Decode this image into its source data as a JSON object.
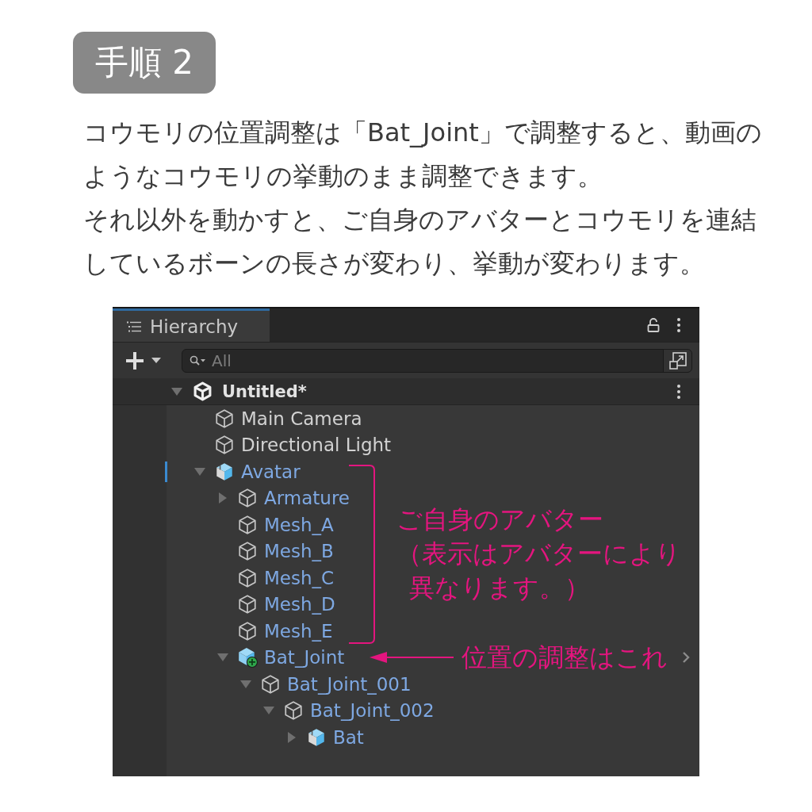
{
  "step_badge": "手順 2",
  "instructions": [
    "コウモリの位置調整は「Bat_Joint」で調整すると、動画のようなコウモリの挙動のまま調整できます。",
    "それ以外を動かすと、ご自身のアバターとコウモリを連結しているボーンの長さが変わり、挙動が変わります。"
  ],
  "hierarchy": {
    "tab": {
      "label": "Hierarchy",
      "selected": true
    },
    "search": {
      "placeholder": "All"
    },
    "scene": {
      "name": "Untitled*",
      "expanded": true
    },
    "nodes": [
      {
        "name": "Main Camera",
        "kind": "object",
        "marked": false,
        "chevron": false
      },
      {
        "name": "Directional Light",
        "kind": "object",
        "marked": false,
        "chevron": false
      },
      {
        "name": "Avatar",
        "kind": "prefab",
        "expanded": true,
        "marked": true,
        "chevron": false,
        "children": [
          {
            "name": "Armature",
            "kind": "prefab-part",
            "expanded": false,
            "marked": false,
            "chevron": false
          },
          {
            "name": "Mesh_A",
            "kind": "prefab-part",
            "marked": false,
            "chevron": false
          },
          {
            "name": "Mesh_B",
            "kind": "prefab-part",
            "marked": false,
            "chevron": false
          },
          {
            "name": "Mesh_C",
            "kind": "prefab-part",
            "marked": false,
            "chevron": false
          },
          {
            "name": "Mesh_D",
            "kind": "prefab-part",
            "marked": false,
            "chevron": false
          },
          {
            "name": "Mesh_E",
            "kind": "prefab-part",
            "marked": false,
            "chevron": false
          },
          {
            "name": "Bat_Joint",
            "kind": "added",
            "expanded": true,
            "marked": false,
            "chevron": true,
            "children": [
              {
                "name": "Bat_Joint_001",
                "kind": "prefab-part",
                "expanded": true,
                "marked": false,
                "chevron": false,
                "children": [
                  {
                    "name": "Bat_Joint_002",
                    "kind": "prefab-part",
                    "expanded": true,
                    "marked": false,
                    "chevron": false,
                    "children": [
                      {
                        "name": "Bat",
                        "kind": "prefab",
                        "expanded": false,
                        "marked": false,
                        "chevron": false
                      }
                    ]
                  }
                ]
              }
            ]
          }
        ]
      }
    ]
  },
  "annotations": {
    "bracket_label": "ご自身のアバター",
    "bracket_note": "（表示はアバターにより異なります。）",
    "arrow_label": "位置の調整はこれ"
  }
}
